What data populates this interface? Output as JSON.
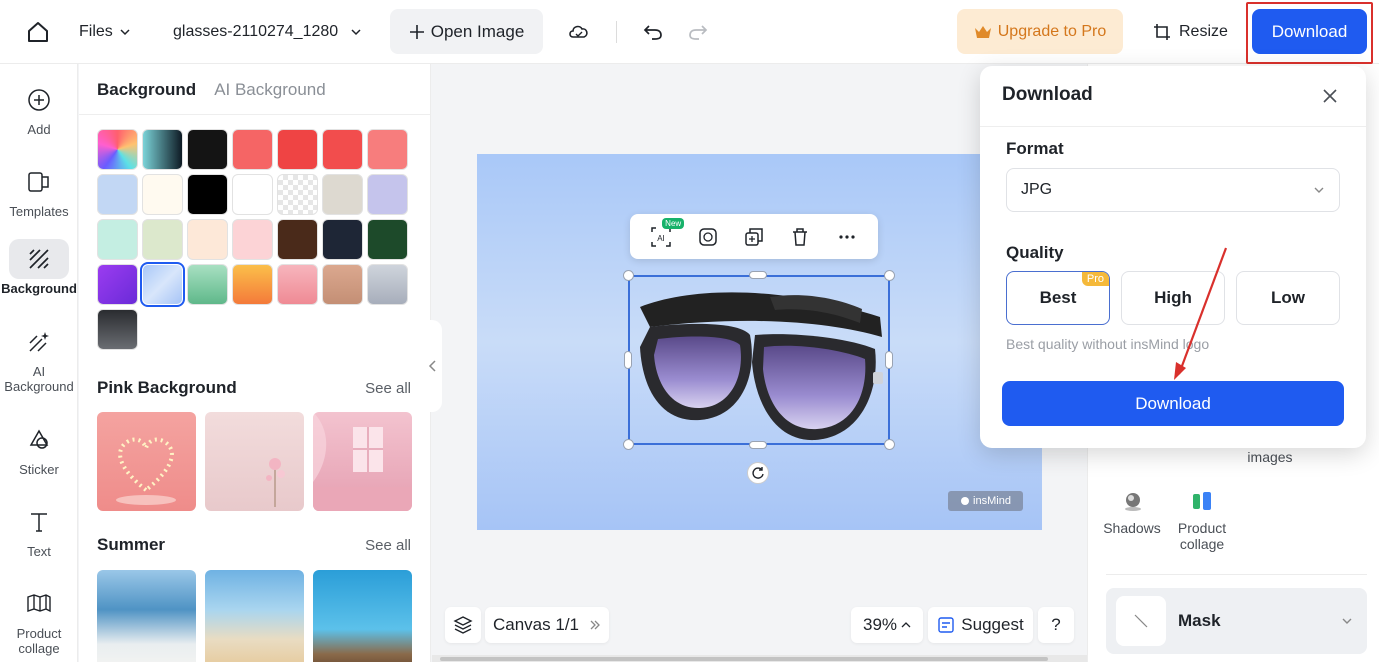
{
  "topbar": {
    "files_label": "Files",
    "file_name": "glasses-2110274_1280",
    "open_image_label": "Open Image",
    "upgrade_label": "Upgrade to Pro",
    "resize_label": "Resize",
    "download_label": "Download"
  },
  "rail": {
    "items": [
      {
        "label": "Add"
      },
      {
        "label": "Templates"
      },
      {
        "label": "Background"
      },
      {
        "label": "AI Background"
      },
      {
        "label": "Sticker"
      },
      {
        "label": "Text"
      },
      {
        "label": "Product collage"
      }
    ]
  },
  "panel": {
    "tab_active": "Background",
    "tab_inactive": "AI Background",
    "pink_title": "Pink Background",
    "summer_title": "Summer",
    "see_all": "See all"
  },
  "canvas": {
    "watermark": "insMind",
    "new_badge": "New",
    "ai_label": "AI"
  },
  "bottombar": {
    "canvas_label": "Canvas 1/1",
    "zoom": "39%",
    "suggest_label": "Suggest",
    "help_label": "?"
  },
  "rpanel": {
    "images_label": "images",
    "shadows_label": "Shadows",
    "product_collage_label": "Product collage",
    "mask_label": "Mask"
  },
  "popup": {
    "title": "Download",
    "format_label": "Format",
    "format_value": "JPG",
    "quality_label": "Quality",
    "quality_options": [
      "Best",
      "High",
      "Low"
    ],
    "pro_badge": "Pro",
    "hint": "Best quality without insMind logo",
    "download_label": "Download"
  },
  "colors": {
    "accent": "#1f5bf0",
    "highlight_border": "#d9302c",
    "upgrade_bg": "#fdebd3",
    "upgrade_text": "#d4771c",
    "pro_badge": "#f5b93a"
  }
}
